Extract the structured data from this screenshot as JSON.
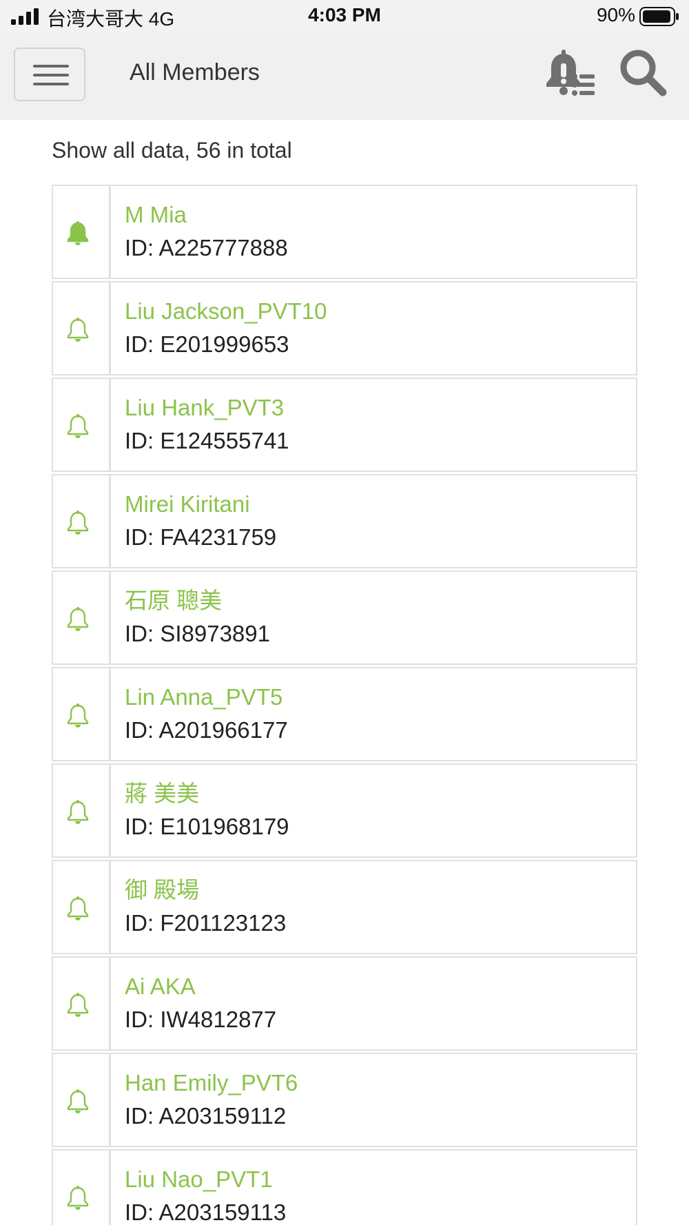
{
  "status_bar": {
    "carrier": "台湾大哥大  4G",
    "time": "4:03 PM",
    "battery": "90%"
  },
  "header": {
    "title": "All Members",
    "icons": [
      "hamburger-menu-icon",
      "alert-list-icon",
      "search-icon"
    ]
  },
  "summary": "Show all data, 56 in total",
  "members": [
    {
      "name": "M Mia",
      "id": "ID: A225777888",
      "bell": "filled"
    },
    {
      "name": "Liu Jackson_PVT10",
      "id": "ID: E201999653",
      "bell": "outline"
    },
    {
      "name": "Liu Hank_PVT3",
      "id": "ID: E124555741",
      "bell": "outline"
    },
    {
      "name": "Mirei Kiritani",
      "id": "ID: FA4231759",
      "bell": "outline"
    },
    {
      "name": "石原 聰美",
      "id": "ID: SI8973891",
      "bell": "outline"
    },
    {
      "name": "Lin Anna_PVT5",
      "id": "ID: A201966177",
      "bell": "outline"
    },
    {
      "name": "蔣 美美",
      "id": "ID: E101968179",
      "bell": "outline"
    },
    {
      "name": "御 殿場",
      "id": "ID: F201123123",
      "bell": "outline"
    },
    {
      "name": "Ai AKA",
      "id": "ID: IW4812877",
      "bell": "outline"
    },
    {
      "name": "Han Emily_PVT6",
      "id": "ID: A203159112",
      "bell": "outline"
    },
    {
      "name": "Liu Nao_PVT1",
      "id": "ID: A203159113",
      "bell": "outline"
    }
  ],
  "colors": {
    "accent_green": "#8bc34a",
    "header_bg": "#f0f0f0",
    "border": "#e0e0e0"
  }
}
